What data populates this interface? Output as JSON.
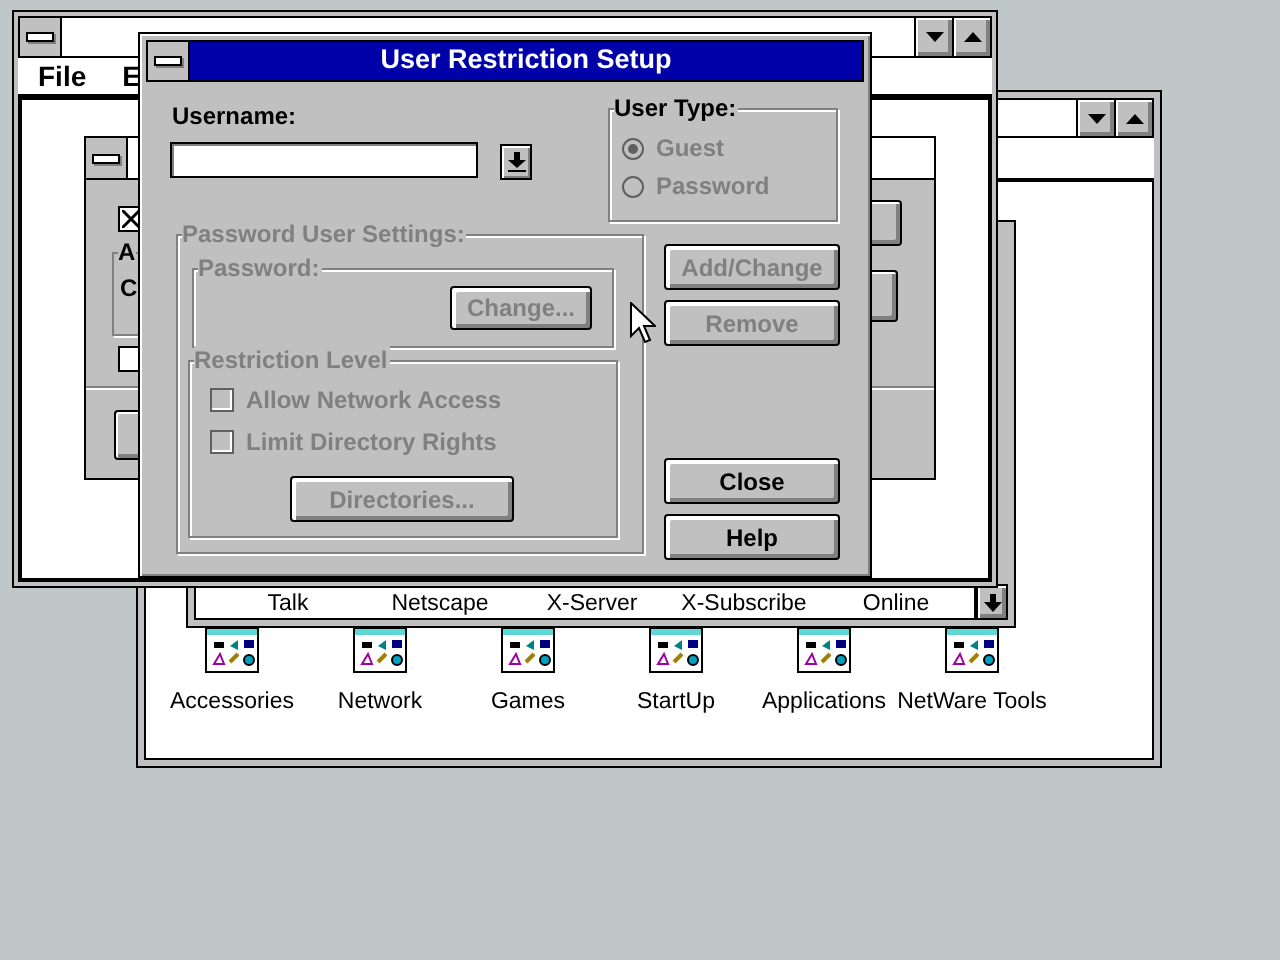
{
  "program_manager": {
    "groups": [
      {
        "label": "Accessories"
      },
      {
        "label": "Network"
      },
      {
        "label": "Games"
      },
      {
        "label": "StartUp"
      },
      {
        "label": "Applications"
      },
      {
        "label": "NetWare Tools"
      }
    ]
  },
  "group_window": {
    "items": [
      {
        "label": "Talk"
      },
      {
        "label": "Netscape"
      },
      {
        "label": "X-Server"
      },
      {
        "label": "X-Subscribe"
      },
      {
        "label": "Online"
      }
    ]
  },
  "session_window": {
    "menu": [
      {
        "label": "File"
      },
      {
        "label": "E"
      }
    ],
    "inner_dialog": {
      "option_checked": true,
      "group_label": "A",
      "group_text": "C",
      "second_option_checked": false
    }
  },
  "dialog": {
    "title": "User Restriction Setup",
    "username": {
      "label": "Username:"
    },
    "user_type": {
      "label": "User Type:",
      "disabled": true,
      "options": [
        {
          "label": "Guest",
          "selected": true
        },
        {
          "label": "Password",
          "selected": false
        }
      ]
    },
    "password_settings": {
      "label": "Password User Settings:",
      "disabled": true,
      "password": {
        "label": "Password:",
        "button": "Change..."
      },
      "restriction": {
        "label": "Restriction Level",
        "options": [
          {
            "label": "Allow Network Access",
            "checked": false
          },
          {
            "label": "Limit Directory Rights",
            "checked": false
          }
        ],
        "button": "Directories..."
      }
    },
    "buttons": [
      {
        "label": "Add/Change",
        "disabled": true
      },
      {
        "label": "Remove",
        "disabled": true
      },
      {
        "label": "Close",
        "disabled": false
      },
      {
        "label": "Help",
        "disabled": false
      }
    ]
  }
}
